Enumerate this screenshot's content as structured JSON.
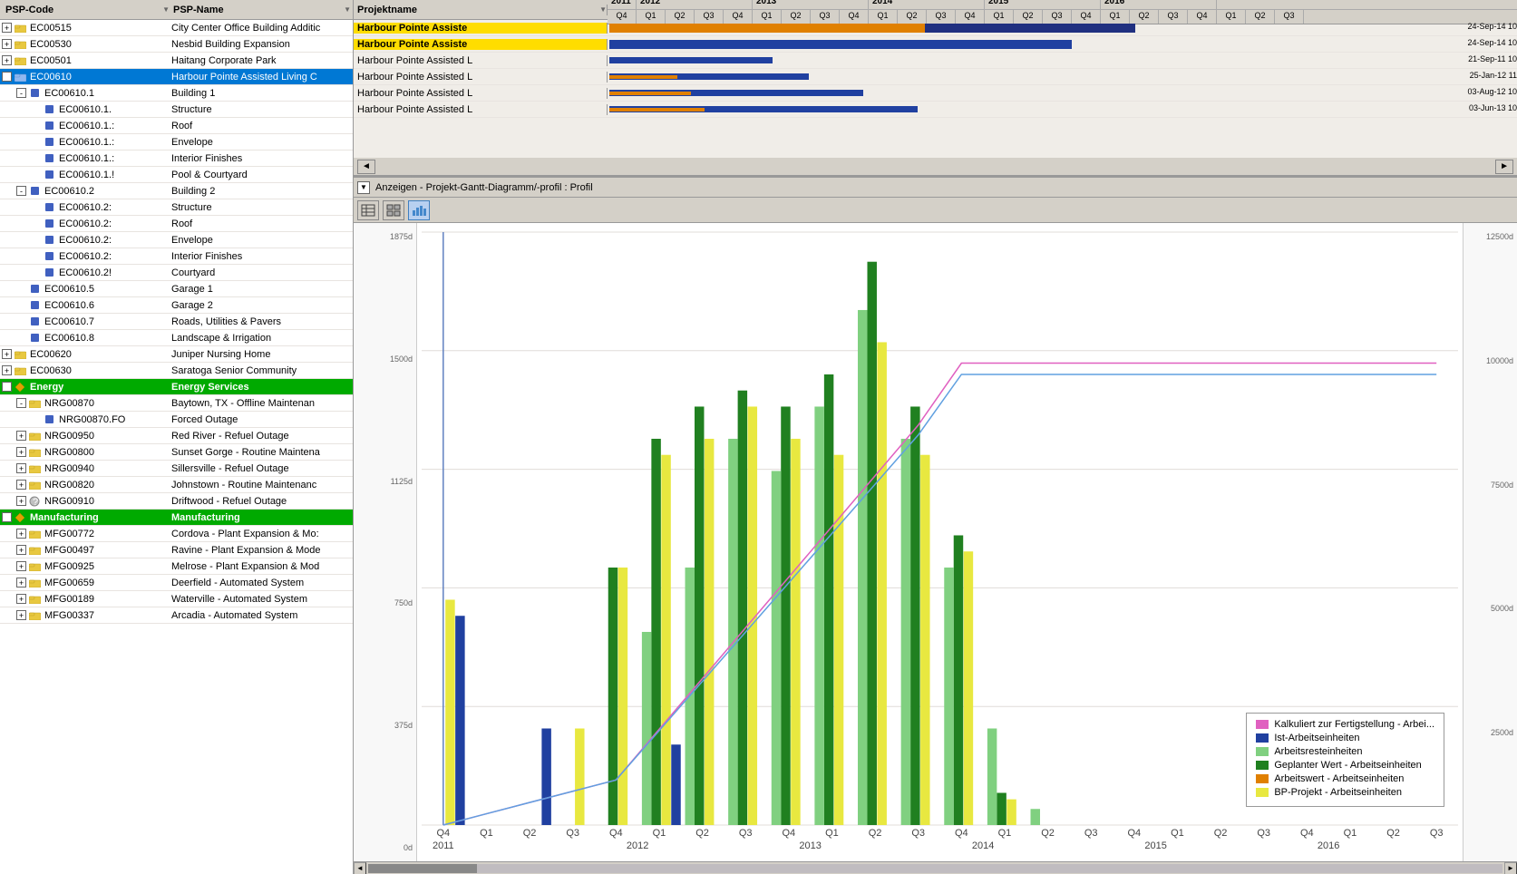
{
  "header": {
    "col1_label": "PSP-Code",
    "col2_label": "PSP-Name",
    "gantt_col_label": "Projektname"
  },
  "tree": {
    "rows": [
      {
        "id": "r1",
        "indent": 0,
        "expand": "+",
        "icon": "folder",
        "code": "EC00515",
        "name": "City Center Office Building Additic",
        "level": 0,
        "selected": false
      },
      {
        "id": "r2",
        "indent": 0,
        "expand": "+",
        "icon": "folder",
        "code": "EC00530",
        "name": "Nesbid Building Expansion",
        "level": 0,
        "selected": false
      },
      {
        "id": "r3",
        "indent": 0,
        "expand": "+",
        "icon": "folder",
        "code": "EC00501",
        "name": "Haitang Corporate Park",
        "level": 0,
        "selected": false
      },
      {
        "id": "r4",
        "indent": 0,
        "expand": "-",
        "icon": "folder",
        "code": "EC00610",
        "name": "Harbour Pointe Assisted Living C",
        "level": 0,
        "selected": true
      },
      {
        "id": "r5",
        "indent": 1,
        "expand": "-",
        "icon": "blue-square",
        "code": "EC00610.1",
        "name": "Building 1",
        "level": 1,
        "selected": false
      },
      {
        "id": "r6",
        "indent": 2,
        "expand": null,
        "icon": "blue-square",
        "code": "EC00610.1.",
        "name": "Structure",
        "level": 2,
        "selected": false
      },
      {
        "id": "r7",
        "indent": 2,
        "expand": null,
        "icon": "blue-square",
        "code": "EC00610.1.:",
        "name": "Roof",
        "level": 2,
        "selected": false
      },
      {
        "id": "r8",
        "indent": 2,
        "expand": null,
        "icon": "blue-square",
        "code": "EC00610.1.:",
        "name": "Envelope",
        "level": 2,
        "selected": false
      },
      {
        "id": "r9",
        "indent": 2,
        "expand": null,
        "icon": "blue-square",
        "code": "EC00610.1.:",
        "name": "Interior Finishes",
        "level": 2,
        "selected": false
      },
      {
        "id": "r10",
        "indent": 2,
        "expand": null,
        "icon": "blue-square",
        "code": "EC00610.1.!",
        "name": "Pool & Courtyard",
        "level": 2,
        "selected": false
      },
      {
        "id": "r11",
        "indent": 1,
        "expand": "-",
        "icon": "blue-square",
        "code": "EC00610.2",
        "name": "Building 2",
        "level": 1,
        "selected": false
      },
      {
        "id": "r12",
        "indent": 2,
        "expand": null,
        "icon": "blue-square",
        "code": "EC00610.2:",
        "name": "Structure",
        "level": 2,
        "selected": false
      },
      {
        "id": "r13",
        "indent": 2,
        "expand": null,
        "icon": "blue-square",
        "code": "EC00610.2:",
        "name": "Roof",
        "level": 2,
        "selected": false
      },
      {
        "id": "r14",
        "indent": 2,
        "expand": null,
        "icon": "blue-square",
        "code": "EC00610.2:",
        "name": "Envelope",
        "level": 2,
        "selected": false
      },
      {
        "id": "r15",
        "indent": 2,
        "expand": null,
        "icon": "blue-square",
        "code": "EC00610.2:",
        "name": "Interior Finishes",
        "level": 2,
        "selected": false
      },
      {
        "id": "r16",
        "indent": 2,
        "expand": null,
        "icon": "blue-square",
        "code": "EC00610.2!",
        "name": "Courtyard",
        "level": 2,
        "selected": false
      },
      {
        "id": "r17",
        "indent": 1,
        "expand": null,
        "icon": "blue-square",
        "code": "EC00610.5",
        "name": "Garage 1",
        "level": 1,
        "selected": false
      },
      {
        "id": "r18",
        "indent": 1,
        "expand": null,
        "icon": "blue-square",
        "code": "EC00610.6",
        "name": "Garage 2",
        "level": 1,
        "selected": false
      },
      {
        "id": "r19",
        "indent": 1,
        "expand": null,
        "icon": "blue-square",
        "code": "EC00610.7",
        "name": "Roads, Utilities & Pavers",
        "level": 1,
        "selected": false
      },
      {
        "id": "r20",
        "indent": 1,
        "expand": null,
        "icon": "blue-square",
        "code": "EC00610.8",
        "name": "Landscape & Irrigation",
        "level": 1,
        "selected": false
      },
      {
        "id": "r21",
        "indent": 0,
        "expand": "+",
        "icon": "folder",
        "code": "EC00620",
        "name": "Juniper Nursing Home",
        "level": 0,
        "selected": false
      },
      {
        "id": "r22",
        "indent": 0,
        "expand": "+",
        "icon": "folder",
        "code": "EC00630",
        "name": "Saratoga Senior Community",
        "level": 0,
        "selected": false
      },
      {
        "id": "r23",
        "indent": 0,
        "expand": "-",
        "icon": "diamond",
        "code": "Energy",
        "name": "Energy Services",
        "level": 0,
        "selected": false,
        "group": true
      },
      {
        "id": "r24",
        "indent": 1,
        "expand": "-",
        "icon": "folder",
        "code": "NRG00870",
        "name": "Baytown, TX - Offline Maintenan",
        "level": 1,
        "selected": false
      },
      {
        "id": "r25",
        "indent": 2,
        "expand": null,
        "icon": "blue-square",
        "code": "NRG00870.FO",
        "name": "Forced Outage",
        "level": 2,
        "selected": false
      },
      {
        "id": "r26",
        "indent": 1,
        "expand": "+",
        "icon": "folder",
        "code": "NRG00950",
        "name": "Red River - Refuel Outage",
        "level": 1,
        "selected": false
      },
      {
        "id": "r27",
        "indent": 1,
        "expand": "+",
        "icon": "folder",
        "code": "NRG00800",
        "name": "Sunset Gorge - Routine Maintena",
        "level": 1,
        "selected": false
      },
      {
        "id": "r28",
        "indent": 1,
        "expand": "+",
        "icon": "folder",
        "code": "NRG00940",
        "name": "Sillersville - Refuel Outage",
        "level": 1,
        "selected": false
      },
      {
        "id": "r29",
        "indent": 1,
        "expand": "+",
        "icon": "folder",
        "code": "NRG00820",
        "name": "Johnstown - Routine Maintenanc",
        "level": 1,
        "selected": false
      },
      {
        "id": "r30",
        "indent": 1,
        "expand": "+",
        "icon": "question",
        "code": "NRG00910",
        "name": "Driftwood - Refuel Outage",
        "level": 1,
        "selected": false
      },
      {
        "id": "r31",
        "indent": 0,
        "expand": "-",
        "icon": "diamond",
        "code": "Manufacturing",
        "name": "Manufacturing",
        "level": 0,
        "selected": false,
        "group": true
      },
      {
        "id": "r32",
        "indent": 1,
        "expand": "+",
        "icon": "folder",
        "code": "MFG00772",
        "name": "Cordova - Plant Expansion & Mo:",
        "level": 1,
        "selected": false
      },
      {
        "id": "r33",
        "indent": 1,
        "expand": "+",
        "icon": "folder",
        "code": "MFG00497",
        "name": "Ravine - Plant Expansion & Mode",
        "level": 1,
        "selected": false
      },
      {
        "id": "r34",
        "indent": 1,
        "expand": "+",
        "icon": "folder",
        "code": "MFG00925",
        "name": "Melrose - Plant Expansion & Mod",
        "level": 1,
        "selected": false
      },
      {
        "id": "r35",
        "indent": 1,
        "expand": "+",
        "icon": "folder",
        "code": "MFG00659",
        "name": "Deerfield - Automated System",
        "level": 1,
        "selected": false
      },
      {
        "id": "r36",
        "indent": 1,
        "expand": "+",
        "icon": "folder",
        "code": "MFG00189",
        "name": "Waterville - Automated System",
        "level": 1,
        "selected": false
      },
      {
        "id": "r37",
        "indent": 1,
        "expand": "+",
        "icon": "folder",
        "code": "MFG00337",
        "name": "Arcadia - Automated System",
        "level": 1,
        "selected": false
      }
    ]
  },
  "gantt": {
    "years": [
      "2011",
      "2012",
      "2013",
      "2014",
      "2015",
      "2016"
    ],
    "quarters": [
      "Q4",
      "Q1",
      "Q2",
      "Q3",
      "Q4",
      "Q1",
      "Q2",
      "Q3",
      "Q4",
      "Q1",
      "Q2",
      "Q3",
      "Q4",
      "Q1",
      "Q2",
      "Q3",
      "Q4",
      "Q1",
      "Q2",
      "Q3",
      "Q4",
      "Q1",
      "Q2",
      "Q3"
    ],
    "rows": [
      {
        "name": "Harbour Pointe Assiste",
        "selected": true,
        "bar_start": 0,
        "bar_end": 580,
        "bar_color": "orange",
        "label": "24-Sep-14 10"
      },
      {
        "name": "Harbour Pointe Assiste",
        "selected": true,
        "bar_start": 0,
        "bar_end": 510,
        "bar_color": "blue",
        "label": "24-Sep-14 10"
      },
      {
        "name": "Harbour Pointe Assisted L",
        "selected": false,
        "bar_start": 0,
        "bar_end": 180,
        "bar_color": "blue",
        "label": "21-Sep-11 10"
      },
      {
        "name": "Harbour Pointe Assisted L",
        "selected": false,
        "bar_start": 0,
        "bar_end": 220,
        "bar_color": "blue",
        "label": "25-Jan-12 11"
      },
      {
        "name": "Harbour Pointe Assisted L",
        "selected": false,
        "bar_start": 0,
        "bar_end": 280,
        "bar_color": "blue",
        "label": "03-Aug-12 10"
      },
      {
        "name": "Harbour Pointe Assisted L",
        "selected": false,
        "bar_start": 0,
        "bar_end": 340,
        "bar_color": "blue",
        "label": "03-Jun-13 10"
      }
    ]
  },
  "profile_label": "Anzeigen - Projekt-Gantt-Diagramm/-profil : Profil",
  "chart": {
    "y_labels_left": [
      "1875d",
      "1500d",
      "1125d",
      "750d",
      "375d",
      "0d"
    ],
    "y_labels_right": [
      "12500d",
      "10000d",
      "7500d",
      "5000d",
      "2500d",
      ""
    ],
    "x_labels": [
      "Q4",
      "Q1",
      "Q2",
      "Q3",
      "Q4",
      "Q1",
      "Q2",
      "Q3",
      "Q4",
      "Q1",
      "Q2",
      "Q3",
      "Q4",
      "Q1",
      "Q2",
      "Q3",
      "Q4",
      "Q1",
      "Q2",
      "Q3",
      "Q4",
      "Q1",
      "Q2",
      "Q3"
    ],
    "x_year_labels": [
      {
        "label": "2011",
        "pos": 1
      },
      {
        "label": "2012",
        "pos": 5
      },
      {
        "label": "2013",
        "pos": 9
      },
      {
        "label": "2014",
        "pos": 13
      },
      {
        "label": "2015",
        "pos": 17
      },
      {
        "label": "2016",
        "pos": 21
      }
    ],
    "bars": [
      {
        "quarter": 0,
        "blue_height": 65,
        "green_light_height": 0,
        "green_dark_height": 0,
        "yellow_height": 70
      },
      {
        "quarter": 1,
        "blue_height": 0,
        "green_light_height": 0,
        "green_dark_height": 0,
        "yellow_height": 0
      },
      {
        "quarter": 2,
        "blue_height": 30,
        "green_light_height": 0,
        "green_dark_height": 0,
        "yellow_height": 0
      },
      {
        "quarter": 3,
        "blue_height": 0,
        "green_light_height": 0,
        "green_dark_height": 0,
        "yellow_height": 30
      },
      {
        "quarter": 4,
        "blue_height": 0,
        "green_light_height": 0,
        "green_dark_height": 80,
        "yellow_height": 80
      },
      {
        "quarter": 5,
        "blue_height": 25,
        "green_light_height": 60,
        "green_dark_height": 120,
        "yellow_height": 115
      },
      {
        "quarter": 6,
        "blue_height": 0,
        "green_light_height": 80,
        "green_dark_height": 130,
        "yellow_height": 120
      },
      {
        "quarter": 7,
        "blue_height": 0,
        "green_light_height": 120,
        "green_dark_height": 135,
        "yellow_height": 130
      },
      {
        "quarter": 8,
        "blue_height": 0,
        "green_light_height": 110,
        "green_dark_height": 130,
        "yellow_height": 120
      },
      {
        "quarter": 9,
        "blue_height": 0,
        "green_light_height": 130,
        "green_dark_height": 140,
        "yellow_height": 115
      },
      {
        "quarter": 10,
        "blue_height": 0,
        "green_light_height": 160,
        "green_dark_height": 175,
        "yellow_height": 150
      },
      {
        "quarter": 11,
        "blue_height": 0,
        "green_light_height": 120,
        "green_dark_height": 130,
        "yellow_height": 115
      },
      {
        "quarter": 12,
        "blue_height": 0,
        "green_light_height": 80,
        "green_dark_height": 90,
        "yellow_height": 85
      },
      {
        "quarter": 13,
        "blue_height": 0,
        "green_light_height": 30,
        "green_dark_height": 10,
        "yellow_height": 8
      },
      {
        "quarter": 14,
        "blue_height": 0,
        "green_light_height": 5,
        "green_dark_height": 0,
        "yellow_height": 0
      },
      {
        "quarter": 15,
        "blue_height": 0,
        "green_light_height": 0,
        "green_dark_height": 0,
        "yellow_height": 0
      }
    ],
    "legend": [
      {
        "color": "#e060c0",
        "label": "Kalkuliert zur Fertigstellung - Arbei..."
      },
      {
        "color": "#2040a0",
        "label": "Ist-Arbeitseinheiten"
      },
      {
        "color": "#80d080",
        "label": "Arbeitsresteinheiten"
      },
      {
        "color": "#208020",
        "label": "Geplanter Wert - Arbeitseinheiten"
      },
      {
        "color": "#e08000",
        "label": "Arbeitswert - Arbeitseinheiten"
      },
      {
        "color": "#e8e840",
        "label": "BP-Projekt - Arbeitseinheiten"
      }
    ]
  }
}
